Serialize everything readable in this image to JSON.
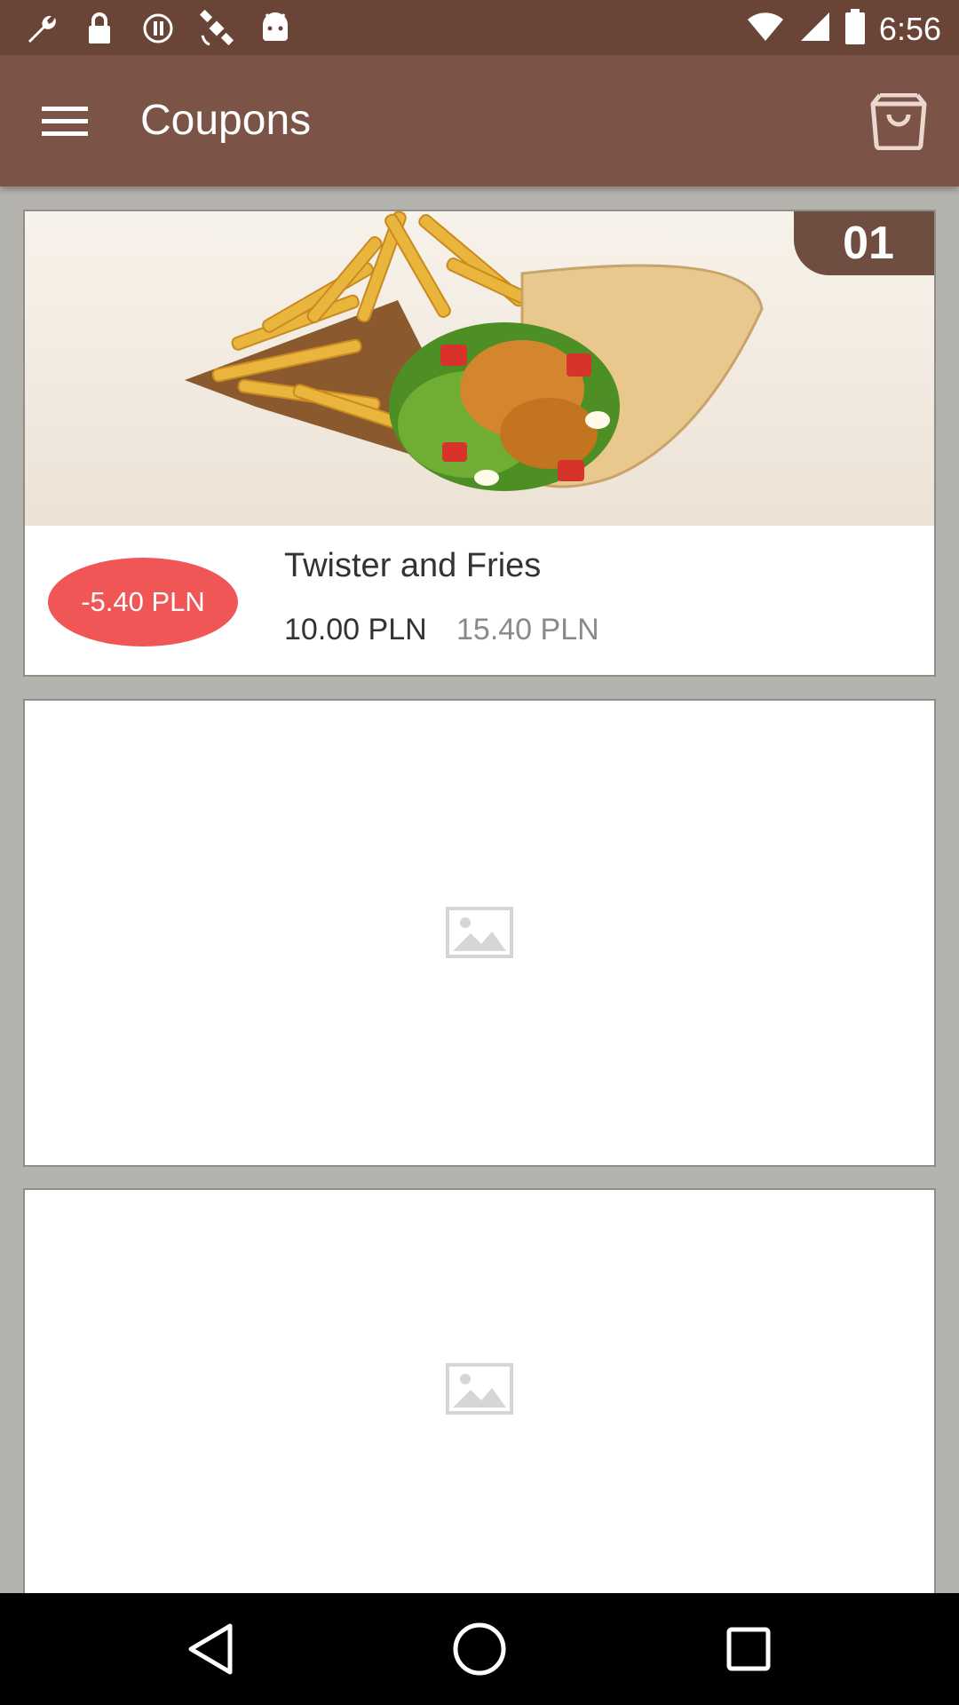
{
  "status_bar": {
    "time": "6:56",
    "icons": [
      "wrench-icon",
      "lock-icon",
      "alert-icon",
      "satellite-icon",
      "android-icon",
      "wifi-icon",
      "signal-icon",
      "battery-icon"
    ]
  },
  "app_bar": {
    "title": "Coupons",
    "menu_icon": "menu-icon",
    "cart_icon": "shopping-bag-icon"
  },
  "coupons": [
    {
      "number": "01",
      "discount": "-5.40 PLN",
      "title": "Twister and Fries",
      "price_new": "10.00 PLN",
      "price_old": "15.40 PLN"
    }
  ],
  "colors": {
    "status_bar": "#6a4436",
    "app_bar": "#7b5447",
    "badge": "#6f4d41",
    "discount": "#f05656",
    "background": "#b3b2ac"
  }
}
